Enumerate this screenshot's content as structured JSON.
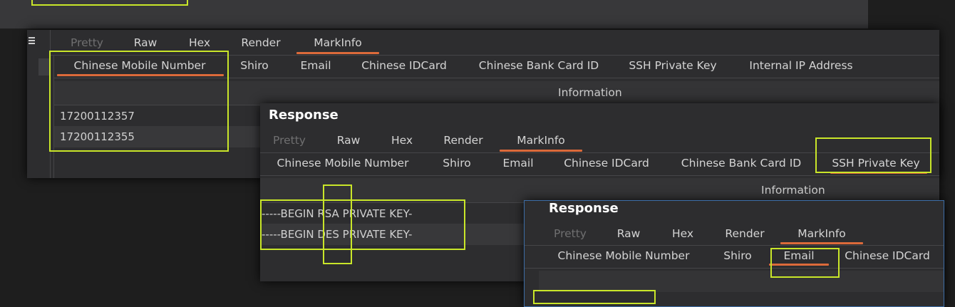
{
  "panel_a": {
    "menu_icon": "hamburger-menu-icon",
    "view_tabs": [
      "Pretty",
      "Raw",
      "Hex",
      "Render",
      "MarkInfo"
    ],
    "sub_tabs": [
      "Chinese Mobile Number",
      "Shiro",
      "Email",
      "Chinese IDCard",
      "Chinese Bank Card ID",
      "SSH Private Key",
      "Internal IP Address"
    ],
    "column_header": "Information",
    "rows": [
      "17200112357",
      "17200112355"
    ]
  },
  "panel_b": {
    "title": "Response",
    "view_tabs": [
      "Pretty",
      "Raw",
      "Hex",
      "Render",
      "MarkInfo"
    ],
    "sub_tabs": [
      "Chinese Mobile Number",
      "Shiro",
      "Email",
      "Chinese IDCard",
      "Chinese Bank Card ID",
      "SSH Private Key"
    ],
    "column_header": "Information",
    "rows": [
      "-----BEGIN RSA PRIVATE KEY-",
      "-----BEGIN DES PRIVATE KEY-"
    ]
  },
  "panel_c": {
    "title": "Response",
    "view_tabs": [
      "Pretty",
      "Raw",
      "Hex",
      "Render",
      "MarkInfo"
    ],
    "sub_tabs": [
      "Chinese Mobile Number",
      "Shiro",
      "Email",
      "Chinese IDCard"
    ]
  },
  "colors": {
    "highlight": "#c9e629",
    "active_underline": "#dc6a3a",
    "panel_bg": "#2d2d2f",
    "focus_border": "#3d6ea8"
  }
}
